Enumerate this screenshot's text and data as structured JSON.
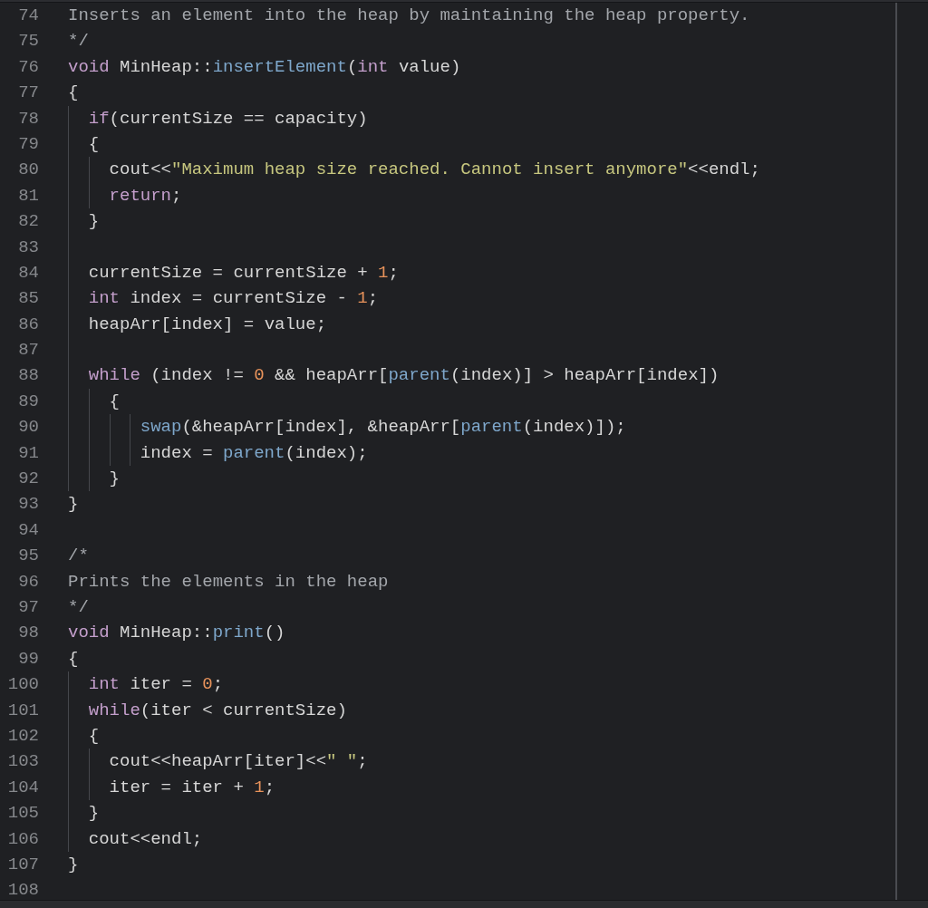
{
  "editor": {
    "lines": [
      {
        "number": "74",
        "tokens": [
          {
            "kind": "comment",
            "text": "Inserts an element into the heap by maintaining the heap property."
          }
        ]
      },
      {
        "number": "75",
        "tokens": [
          {
            "kind": "comment",
            "text": "*/"
          }
        ]
      },
      {
        "number": "76",
        "tokens": [
          {
            "kind": "keyword",
            "text": "void"
          },
          {
            "kind": "plain",
            "text": " MinHeap::"
          },
          {
            "kind": "function",
            "text": "insertElement"
          },
          {
            "kind": "plain",
            "text": "("
          },
          {
            "kind": "keyword",
            "text": "int"
          },
          {
            "kind": "plain",
            "text": " value)"
          }
        ]
      },
      {
        "number": "77",
        "tokens": [
          {
            "kind": "plain",
            "text": "{"
          }
        ]
      },
      {
        "number": "78",
        "tokens": [
          {
            "kind": "keyword",
            "text": "  if"
          },
          {
            "kind": "plain",
            "text": "(currentSize == capacity)"
          }
        ]
      },
      {
        "number": "79",
        "tokens": [
          {
            "kind": "plain",
            "text": "  {"
          }
        ]
      },
      {
        "number": "80",
        "tokens": [
          {
            "kind": "plain",
            "text": "    cout<<"
          },
          {
            "kind": "string",
            "text": "\"Maximum heap size reached. Cannot insert anymore\""
          },
          {
            "kind": "plain",
            "text": "<<endl;"
          }
        ]
      },
      {
        "number": "81",
        "tokens": [
          {
            "kind": "keyword",
            "text": "    return"
          },
          {
            "kind": "plain",
            "text": ";"
          }
        ]
      },
      {
        "number": "82",
        "tokens": [
          {
            "kind": "plain",
            "text": "  }"
          }
        ]
      },
      {
        "number": "83"
      },
      {
        "number": "84",
        "tokens": [
          {
            "kind": "plain",
            "text": "  currentSize = currentSize + "
          },
          {
            "kind": "number",
            "text": "1"
          },
          {
            "kind": "plain",
            "text": ";"
          }
        ]
      },
      {
        "number": "85",
        "tokens": [
          {
            "kind": "keyword",
            "text": "  int"
          },
          {
            "kind": "plain",
            "text": " index = currentSize - "
          },
          {
            "kind": "number",
            "text": "1"
          },
          {
            "kind": "plain",
            "text": ";"
          }
        ]
      },
      {
        "number": "86",
        "tokens": [
          {
            "kind": "plain",
            "text": "  heapArr[index] = value;"
          }
        ]
      },
      {
        "number": "87"
      },
      {
        "number": "88",
        "tokens": [
          {
            "kind": "keyword",
            "text": "  while"
          },
          {
            "kind": "plain",
            "text": " (index != "
          },
          {
            "kind": "number",
            "text": "0"
          },
          {
            "kind": "plain",
            "text": " && heapArr["
          },
          {
            "kind": "function",
            "text": "parent"
          },
          {
            "kind": "plain",
            "text": "(index)] > heapArr[index])"
          }
        ]
      },
      {
        "number": "89",
        "tokens": [
          {
            "kind": "plain",
            "text": "    {"
          }
        ]
      },
      {
        "number": "90",
        "tokens": [
          {
            "kind": "function",
            "text": "       swap"
          },
          {
            "kind": "plain",
            "text": "(&heapArr[index], &heapArr["
          },
          {
            "kind": "function",
            "text": "parent"
          },
          {
            "kind": "plain",
            "text": "(index)]);"
          }
        ]
      },
      {
        "number": "91",
        "tokens": [
          {
            "kind": "plain",
            "text": "       index = "
          },
          {
            "kind": "function",
            "text": "parent"
          },
          {
            "kind": "plain",
            "text": "(index);"
          }
        ]
      },
      {
        "number": "92",
        "tokens": [
          {
            "kind": "plain",
            "text": "    }"
          }
        ]
      },
      {
        "number": "93",
        "tokens": [
          {
            "kind": "plain",
            "text": "}"
          }
        ]
      },
      {
        "number": "94"
      },
      {
        "number": "95",
        "tokens": [
          {
            "kind": "comment",
            "text": "/*"
          }
        ]
      },
      {
        "number": "96",
        "tokens": [
          {
            "kind": "comment",
            "text": "Prints the elements in the heap"
          }
        ]
      },
      {
        "number": "97",
        "tokens": [
          {
            "kind": "comment",
            "text": "*/"
          }
        ]
      },
      {
        "number": "98",
        "tokens": [
          {
            "kind": "keyword",
            "text": "void"
          },
          {
            "kind": "plain",
            "text": " MinHeap::"
          },
          {
            "kind": "function",
            "text": "print"
          },
          {
            "kind": "plain",
            "text": "()"
          }
        ]
      },
      {
        "number": "99",
        "tokens": [
          {
            "kind": "plain",
            "text": "{"
          }
        ]
      },
      {
        "number": "100",
        "tokens": [
          {
            "kind": "keyword",
            "text": "  int"
          },
          {
            "kind": "plain",
            "text": " iter = "
          },
          {
            "kind": "number",
            "text": "0"
          },
          {
            "kind": "plain",
            "text": ";"
          }
        ]
      },
      {
        "number": "101",
        "tokens": [
          {
            "kind": "keyword",
            "text": "  while"
          },
          {
            "kind": "plain",
            "text": "(iter < currentSize)"
          }
        ]
      },
      {
        "number": "102",
        "tokens": [
          {
            "kind": "plain",
            "text": "  {"
          }
        ]
      },
      {
        "number": "103",
        "tokens": [
          {
            "kind": "plain",
            "text": "    cout<<heapArr[iter]<<"
          },
          {
            "kind": "string",
            "text": "\" \""
          },
          {
            "kind": "plain",
            "text": ";"
          }
        ]
      },
      {
        "number": "104",
        "tokens": [
          {
            "kind": "plain",
            "text": "    iter = iter + "
          },
          {
            "kind": "number",
            "text": "1"
          },
          {
            "kind": "plain",
            "text": ";"
          }
        ]
      },
      {
        "number": "105",
        "tokens": [
          {
            "kind": "plain",
            "text": "  }"
          }
        ]
      },
      {
        "number": "106",
        "tokens": [
          {
            "kind": "plain",
            "text": "  cout<<endl;"
          }
        ]
      },
      {
        "number": "107",
        "tokens": [
          {
            "kind": "plain",
            "text": "}"
          }
        ]
      },
      {
        "number": "108"
      }
    ]
  }
}
